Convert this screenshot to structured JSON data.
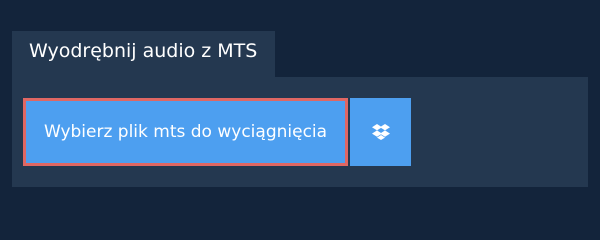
{
  "tab": {
    "title": "Wyodrębnij audio z MTS"
  },
  "upload": {
    "button_label": "Wybierz plik mts do wyciągnięcia",
    "dropbox_icon": "dropbox-icon"
  },
  "colors": {
    "background": "#13243b",
    "panel": "#243850",
    "button": "#4d9ff0",
    "focus_border": "#e06763",
    "text": "#ffffff"
  }
}
